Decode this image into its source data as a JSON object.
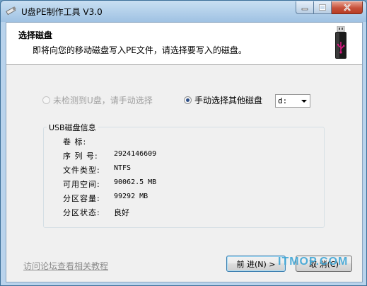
{
  "window": {
    "title": "U盘PE制作工具 V3.0"
  },
  "header": {
    "title": "选择磁盘",
    "subtitle": "即将向您的移动磁盘写入PE文件，请选择要写入的磁盘。",
    "icon": "usb-drive-icon"
  },
  "options": {
    "auto_label": "未检测到U盘，请手动选择",
    "auto_enabled": false,
    "auto_checked": false,
    "manual_label": "手动选择其他磁盘",
    "manual_checked": true,
    "drive_value": "d:"
  },
  "usb_info": {
    "group_title": "USB磁盘信息",
    "rows": [
      {
        "label": "卷    标:",
        "value": ""
      },
      {
        "label": "序 列 号:",
        "value": "2924146609"
      },
      {
        "label": "文件类型:",
        "value": "NTFS"
      },
      {
        "label": "可用空间:",
        "value": "90062.5 MB"
      },
      {
        "label": "分区容量:",
        "value": "99292 MB"
      },
      {
        "label": "分区状态:",
        "value": "良好"
      }
    ]
  },
  "footer": {
    "link_text": "访问论坛查看相关教程",
    "next_label": "前 进(N) >",
    "cancel_label": "取 消(C)"
  },
  "watermark": "ITMOP.COM",
  "colors": {
    "title_bar": "#9fc2e3",
    "close_button": "#c7513a",
    "link": "#8b8b8b",
    "watermark": "#3fa6d6"
  }
}
